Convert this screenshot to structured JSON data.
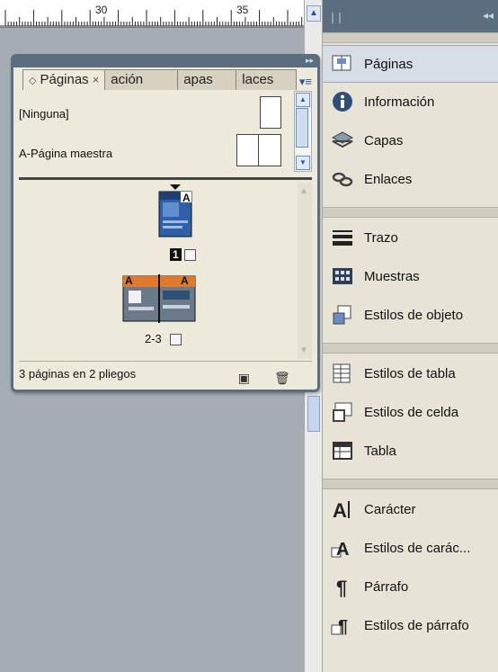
{
  "ruler": {
    "marks": [
      "30",
      "35"
    ]
  },
  "panel": {
    "tabs": [
      {
        "label": "Páginas",
        "close": "×"
      },
      {
        "label": "ación"
      },
      {
        "label": "apas"
      },
      {
        "label": "laces"
      }
    ],
    "masters": [
      {
        "label": "[Ninguna]"
      },
      {
        "label": "A-Página maestra"
      }
    ],
    "pages": [
      {
        "label": "1",
        "master_letter": "A"
      },
      {
        "label": "2-3",
        "master_letter": "A"
      }
    ],
    "footer_status": "3 páginas en 2 pliegos"
  },
  "dock": {
    "groups": [
      [
        {
          "label": "Páginas",
          "icon": "pages-icon",
          "selected": true
        },
        {
          "label": "Información",
          "icon": "info-icon"
        },
        {
          "label": "Capas",
          "icon": "layers-icon"
        },
        {
          "label": "Enlaces",
          "icon": "links-icon"
        }
      ],
      [
        {
          "label": "Trazo",
          "icon": "stroke-icon"
        },
        {
          "label": "Muestras",
          "icon": "swatches-icon"
        },
        {
          "label": "Estilos de objeto",
          "icon": "object-styles-icon"
        }
      ],
      [
        {
          "label": "Estilos de tabla",
          "icon": "table-styles-icon"
        },
        {
          "label": "Estilos de celda",
          "icon": "cell-styles-icon"
        },
        {
          "label": "Tabla",
          "icon": "table-icon"
        }
      ],
      [
        {
          "label": "Carácter",
          "icon": "character-icon"
        },
        {
          "label": "Estilos de carác...",
          "icon": "character-styles-icon"
        },
        {
          "label": "Párrafo",
          "icon": "paragraph-icon"
        },
        {
          "label": "Estilos de párrafo",
          "icon": "paragraph-styles-icon"
        }
      ]
    ]
  }
}
